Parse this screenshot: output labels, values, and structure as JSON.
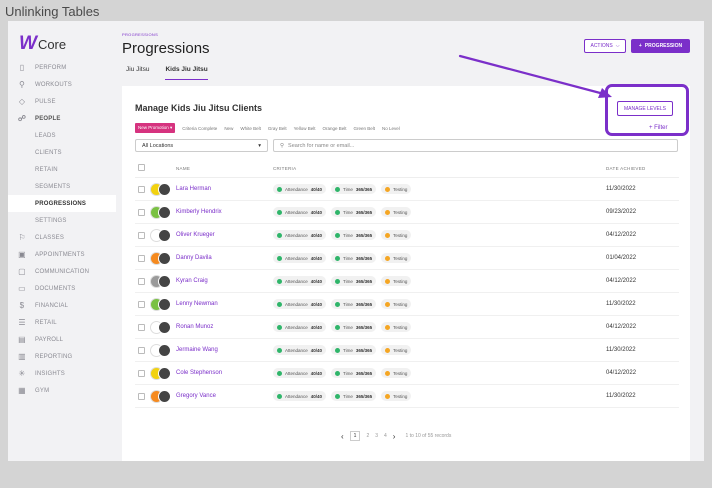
{
  "caption": "Unlinking Tables",
  "logo": {
    "mark": "W",
    "text": "Core"
  },
  "nav": [
    {
      "label": "PERFORM",
      "icon": "perform-icon",
      "glyph": "▯",
      "type": "main"
    },
    {
      "label": "WORKOUTS",
      "icon": "workouts-icon",
      "glyph": "⚲",
      "type": "main"
    },
    {
      "label": "PULSE",
      "icon": "pulse-icon",
      "glyph": "◇",
      "type": "main"
    },
    {
      "label": "PEOPLE",
      "icon": "people-icon",
      "glyph": "☍",
      "type": "strong"
    },
    {
      "label": "LEADS",
      "type": "sub"
    },
    {
      "label": "CLIENTS",
      "type": "sub"
    },
    {
      "label": "RETAIN",
      "type": "sub"
    },
    {
      "label": "SEGMENTS",
      "type": "sub"
    },
    {
      "label": "PROGRESSIONS",
      "type": "active"
    },
    {
      "label": "SETTINGS",
      "type": "sub"
    },
    {
      "label": "CLASSES",
      "icon": "classes-icon",
      "glyph": "⚐",
      "type": "main"
    },
    {
      "label": "APPOINTMENTS",
      "icon": "appointments-icon",
      "glyph": "▣",
      "type": "main"
    },
    {
      "label": "COMMUNICATION",
      "icon": "communication-icon",
      "glyph": "▢",
      "type": "main"
    },
    {
      "label": "DOCUMENTS",
      "icon": "documents-icon",
      "glyph": "▭",
      "type": "main"
    },
    {
      "label": "FINANCIAL",
      "icon": "financial-icon",
      "glyph": "$",
      "type": "main"
    },
    {
      "label": "RETAIL",
      "icon": "retail-icon",
      "glyph": "☰",
      "type": "main"
    },
    {
      "label": "PAYROLL",
      "icon": "payroll-icon",
      "glyph": "▤",
      "type": "main"
    },
    {
      "label": "REPORTING",
      "icon": "reporting-icon",
      "glyph": "▥",
      "type": "main"
    },
    {
      "label": "INSIGHTS",
      "icon": "insights-icon",
      "glyph": "✳",
      "type": "main"
    },
    {
      "label": "GYM",
      "icon": "gym-icon",
      "glyph": "▦",
      "type": "main"
    }
  ],
  "header": {
    "breadcrumb": "PROGRESSIONS",
    "title": "Progressions",
    "tabs": [
      "Jiu Jitsu",
      "Kids Jiu Jitsu"
    ],
    "actions_label": "ACTIONS",
    "progression_label": "PROGRESSION"
  },
  "card": {
    "title": "Manage Kids Jiu Jitsu Clients",
    "manage_levels": "MANAGE LEVELS",
    "filter_label": "Filter",
    "new_promotion": "New Promotion",
    "level_filters": [
      "Criteria Complete",
      "New",
      "White Belt",
      "Gray Belt",
      "Yellow Belt",
      "Orange Belt",
      "Green Belt",
      "No Level"
    ],
    "location_select": "All Locations",
    "search_placeholder": "Search for name or email...",
    "columns": {
      "name": "NAME",
      "criteria": "CRITERIA",
      "date": "DATE ACHIEVED"
    }
  },
  "criteria_labels": {
    "attendance": "Attendance",
    "time": "Time",
    "testing": "Testing"
  },
  "colors": {
    "accent": "#7b2fc9",
    "attendance": "#2fb56a",
    "testing": "#f5a623",
    "promo": "#d6337f"
  },
  "rows": [
    {
      "name": "Lara Herman",
      "attendance": "40/40",
      "time": "365/365",
      "date": "11/30/2022",
      "avatar_color": "#f2d20f"
    },
    {
      "name": "Kimberly Hendrix",
      "attendance": "40/40",
      "time": "365/365",
      "date": "09/23/2022",
      "avatar_color": "#7ac143"
    },
    {
      "name": "Oliver Krueger",
      "attendance": "40/40",
      "time": "365/365",
      "date": "04/12/2022",
      "avatar_color": "#ffffff"
    },
    {
      "name": "Danny Davila",
      "attendance": "40/40",
      "time": "365/365",
      "date": "01/04/2022",
      "avatar_color": "#f58a1f"
    },
    {
      "name": "Kyran Craig",
      "attendance": "40/40",
      "time": "365/365",
      "date": "04/12/2022",
      "avatar_color": "#9a9a9a"
    },
    {
      "name": "Lenny Newman",
      "attendance": "40/40",
      "time": "365/365",
      "date": "11/30/2022",
      "avatar_color": "#7ac143"
    },
    {
      "name": "Ronan Munoz",
      "attendance": "40/40",
      "time": "365/365",
      "date": "04/12/2022",
      "avatar_color": "#ffffff"
    },
    {
      "name": "Jermaine Wang",
      "attendance": "40/40",
      "time": "365/365",
      "date": "11/30/2022",
      "avatar_color": "#ffffff"
    },
    {
      "name": "Cole Stephenson",
      "attendance": "40/40",
      "time": "365/365",
      "date": "04/12/2022",
      "avatar_color": "#f2d20f"
    },
    {
      "name": "Gregory Vance",
      "attendance": "40/40",
      "time": "365/365",
      "date": "11/30/2022",
      "avatar_color": "#f58a1f"
    }
  ],
  "pagination": {
    "pages": [
      "1",
      "2",
      "3",
      "4"
    ],
    "current": "1",
    "summary": "1 to 10 of 55 records"
  }
}
